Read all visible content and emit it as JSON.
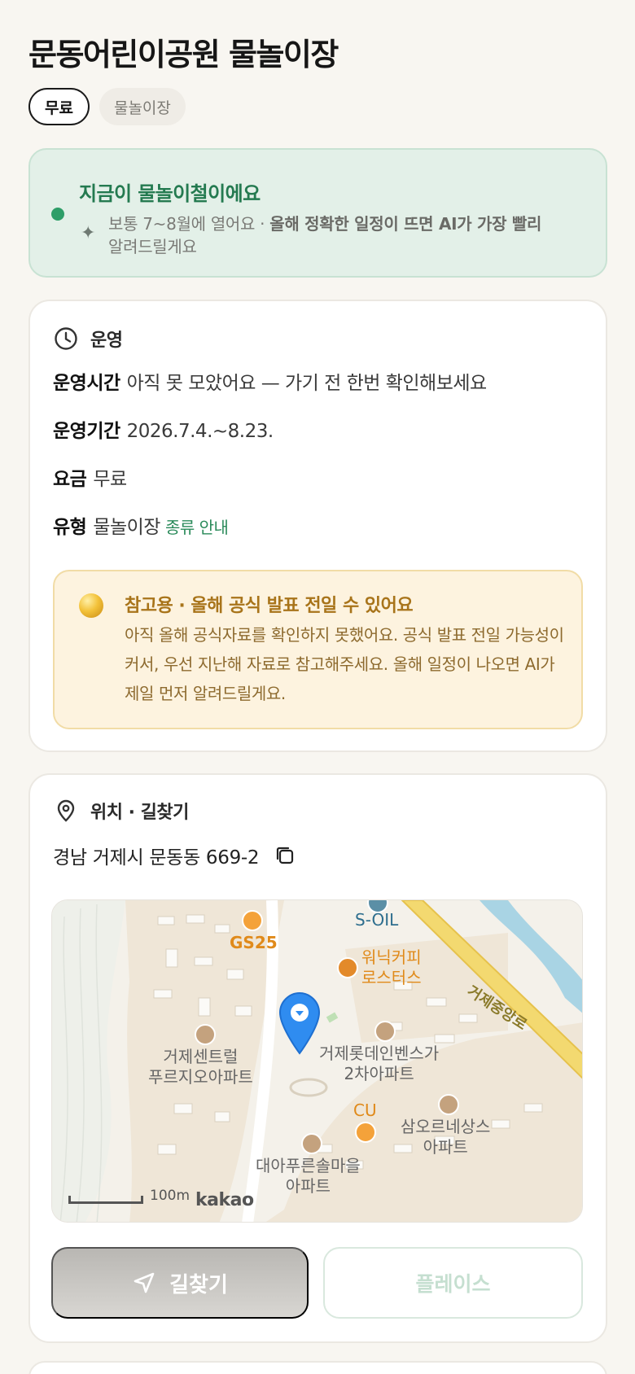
{
  "page": {
    "title": "문동어린이공원 물놀이장",
    "chips": [
      "무료",
      "물놀이장"
    ]
  },
  "season": {
    "title": "지금이 물놀이철이에요",
    "body_plain": "보통 7~8월에 열어요 · ",
    "body_bold": "올해 정확한 일정이 뜨면 AI가 가장 빨리",
    "body_tail": "알려드릴게요",
    "status_color": "#2e9e68",
    "icon": "sparkle-icon"
  },
  "operation": {
    "heading": "운영",
    "icon": "clock-icon",
    "rows": [
      {
        "label": "운영시간",
        "value": "아직 못 모았어요 — 가기 전 한번 확인해보세요"
      },
      {
        "label": "운영기간",
        "value": "2026.7.4.~8.23."
      },
      {
        "label": "요금",
        "value": "무료"
      },
      {
        "label": "유형",
        "value": "물놀이장",
        "link": "종류 안내"
      }
    ],
    "notice": {
      "title": "참고용 · 올해 공식 발표 전일 수 있어요",
      "body": "아직 올해 공식자료를 확인하지 못했어요. 공식 발표 전일 가능성이 커서, 우선 지난해 자료로 참고해주세요. 올해 일정이 나오면 AI가 제일 먼저 알려드릴게요."
    }
  },
  "location": {
    "heading": "위치 · 길찾기",
    "icon": "location-pin-icon",
    "address": "경남 거제시 문동동 669-2",
    "copy_icon": "copy-icon",
    "map": {
      "labels": {
        "soil": "S-OIL",
        "gs25": "GS25",
        "cafe1": "워닉커피",
        "cafe2": "로스터스",
        "road": "거제중앙로",
        "apt1a": "거제센트럴",
        "apt1b": "푸르지오아파트",
        "apt2a": "거제롯데인벤스가",
        "apt2b": "2차아파트",
        "cu": "CU",
        "apt3a": "삼오르네상스",
        "apt3b": "아파트",
        "apt4a": "대아푸른솔마을",
        "apt4b": "아파트",
        "scale": "100m",
        "brand": "kakao"
      }
    },
    "buttons": {
      "directions": "길찾기",
      "place": "플레이스"
    }
  }
}
